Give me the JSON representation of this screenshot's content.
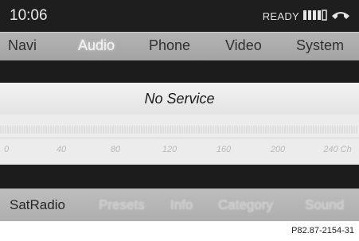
{
  "status_bar": {
    "time": "10:06",
    "status": "READY",
    "signal_icon": "signal-strength-icon",
    "phone_icon": "phone-handset-icon"
  },
  "main_menu": {
    "items": [
      {
        "label": "Navi",
        "active": false
      },
      {
        "label": "Audio",
        "active": true
      },
      {
        "label": "Phone",
        "active": false
      },
      {
        "label": "Video",
        "active": false
      },
      {
        "label": "System",
        "active": false
      }
    ]
  },
  "content": {
    "service_text": "No Service"
  },
  "channel_scale": {
    "labels": [
      "0",
      "40",
      "80",
      "120",
      "160",
      "200",
      "240 Ch"
    ]
  },
  "sub_menu": {
    "items": [
      {
        "label": "SatRadio",
        "active": true
      },
      {
        "label": "Presets",
        "active": false
      },
      {
        "label": "Info",
        "active": false
      },
      {
        "label": "Category",
        "active": false
      },
      {
        "label": "Sound",
        "active": false
      }
    ]
  },
  "figure_ref": "P82.87-2154-31",
  "colors": {
    "screen_bg": "#1c1c1c",
    "menu_bar": "#aaaaaa",
    "active_menu_text": "#f4f4f4",
    "info_band": "#ececec"
  }
}
